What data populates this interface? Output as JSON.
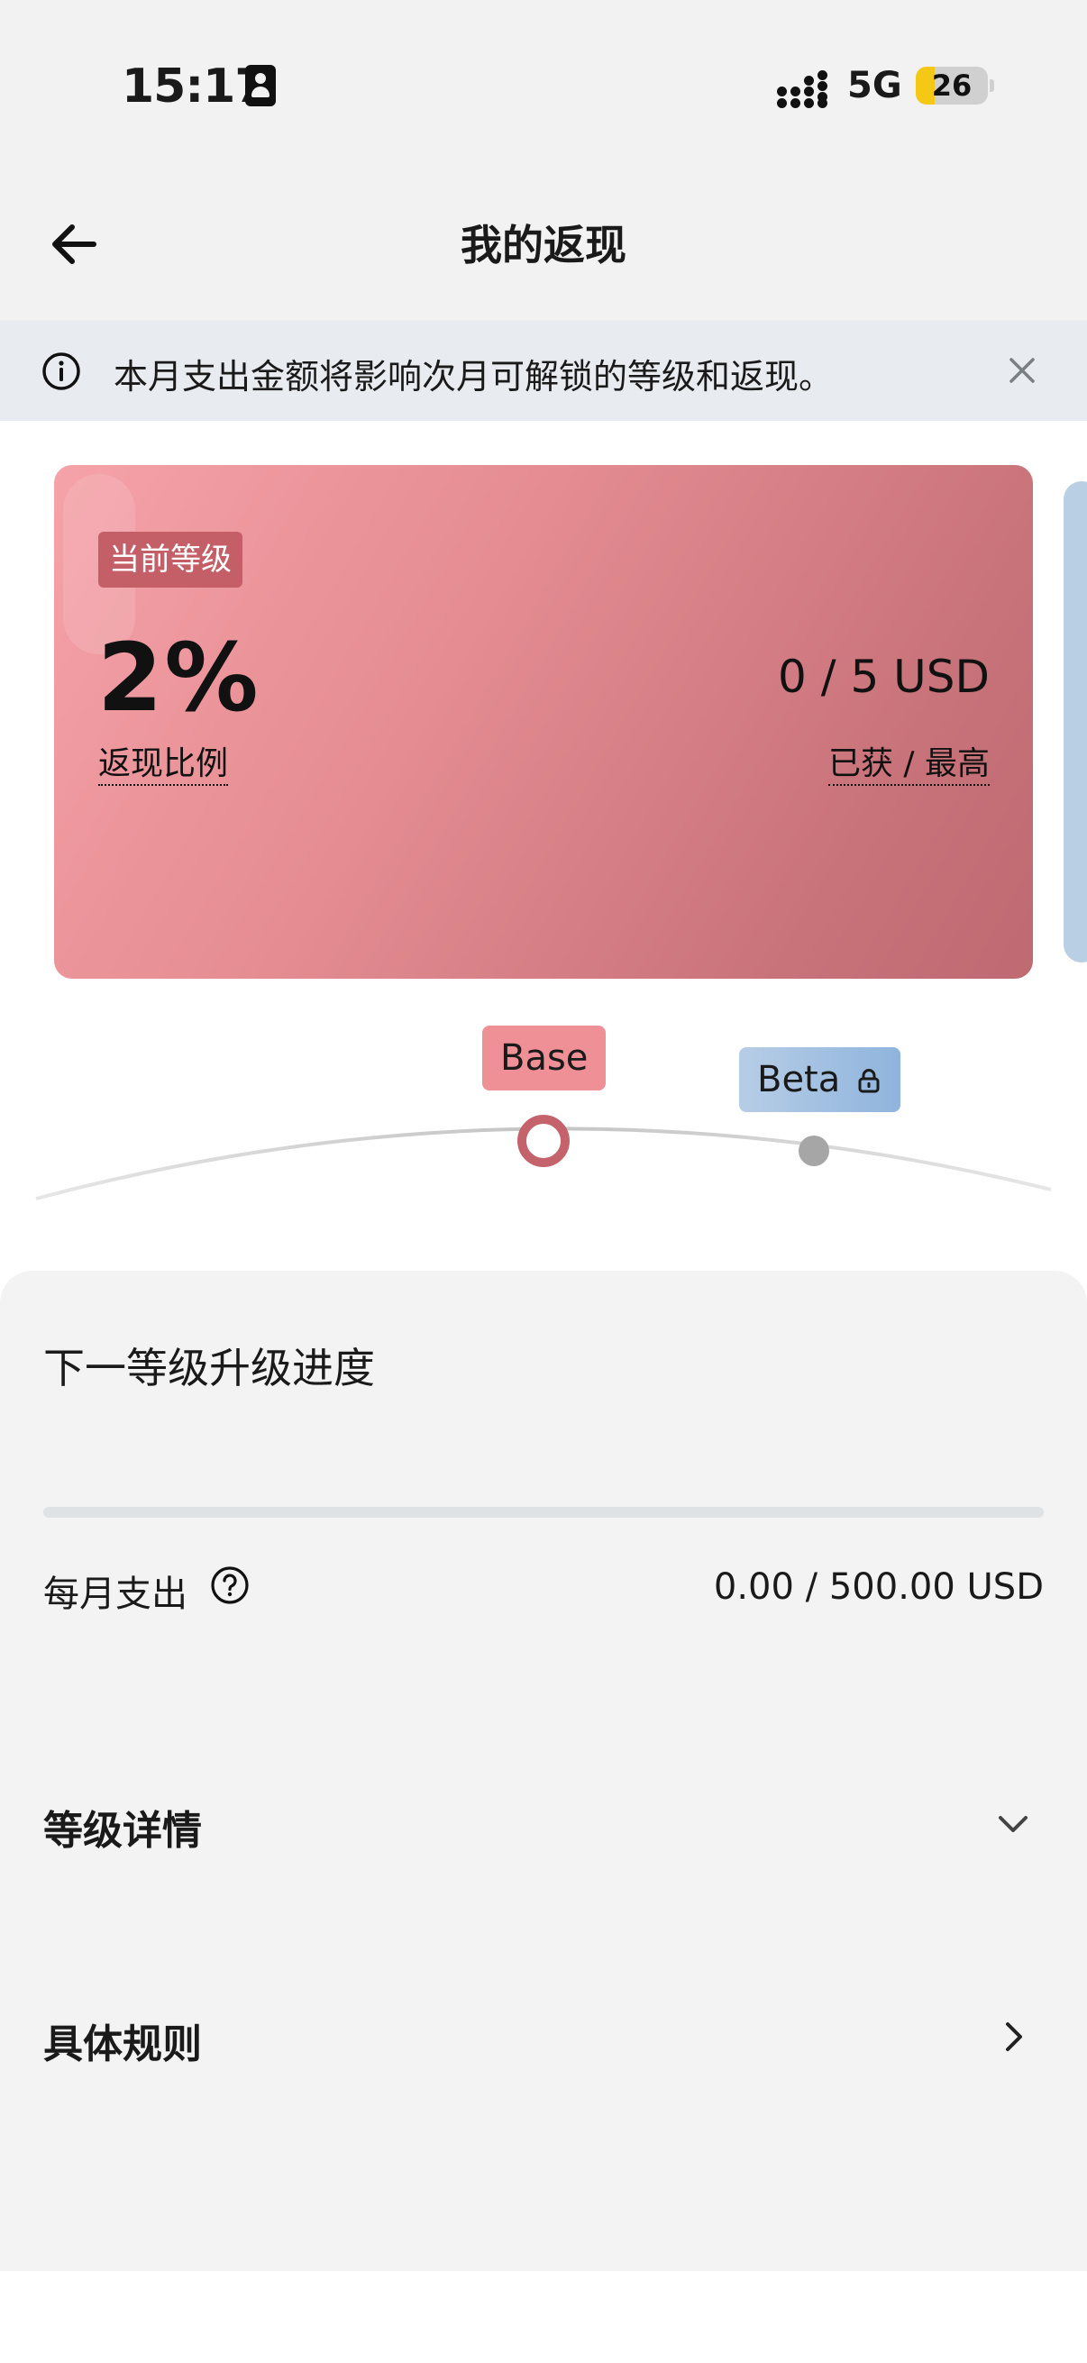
{
  "status_bar": {
    "time": "15:17",
    "network": "5G",
    "battery": "26"
  },
  "header": {
    "title": "我的返现"
  },
  "notice": {
    "text": "本月支出金额将影响次月可解锁的等级和返现。"
  },
  "card": {
    "badge": "当前等级",
    "rate": "2%",
    "rate_label": "返现比例",
    "earned": "0 / 5 USD",
    "earned_label": "已获 / 最高"
  },
  "tiers": {
    "current": "Base",
    "next": "Beta"
  },
  "progress": {
    "title": "下一等级升级进度",
    "fraction": 0,
    "spend_label": "每月支出",
    "spend_value": "0.00 / 500.00 USD"
  },
  "sections": {
    "details": "等级详情",
    "rules": "具体规则"
  },
  "colors": {
    "accent": "#c45e67",
    "card_start": "#f5a2a8",
    "card_end": "#bf6a72",
    "notice_bg": "#e8ebef",
    "panel_bg": "#f3f3f3"
  },
  "icons": {
    "back": "arrow-left-icon",
    "info": "info-icon",
    "close": "close-icon",
    "lock": "lock-icon",
    "help": "question-icon",
    "expand": "chevron-down-icon",
    "navigate": "chevron-right-icon"
  }
}
